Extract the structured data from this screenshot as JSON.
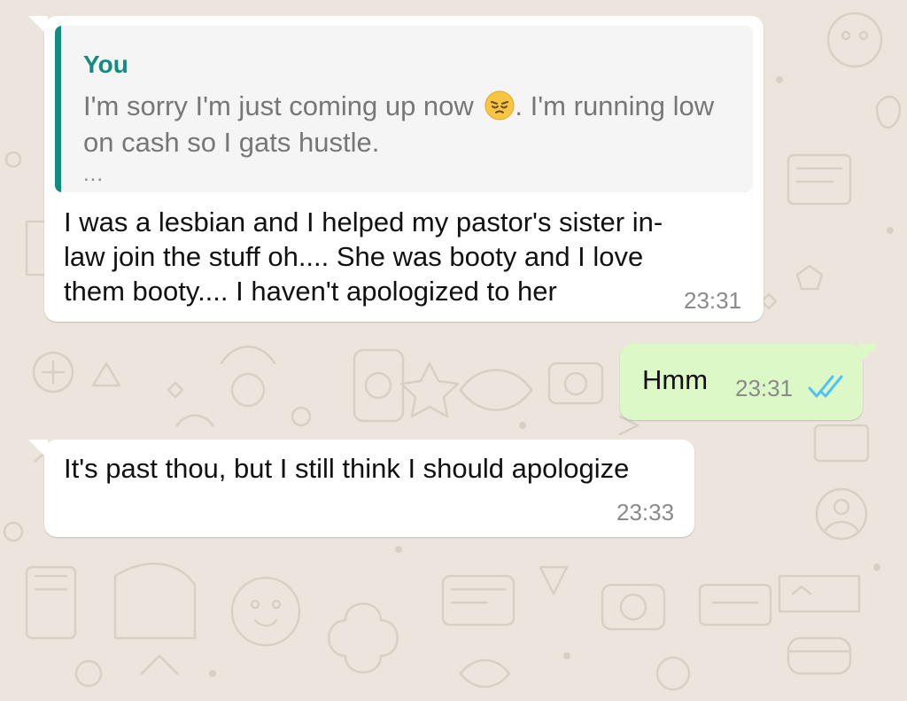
{
  "messages": [
    {
      "direction": "incoming",
      "quote": {
        "author": "You",
        "text_before_emoji": "I'm sorry I'm just coming up now ",
        "text_after_emoji": ". I'm running low on cash so I gats hustle.",
        "ellipsis": "...",
        "emoji": "pensive-face-emoji"
      },
      "lines": [
        "I was a lesbian and I helped my pastor's sister in-",
        "law join the stuff oh.... She was booty and I love",
        "them booty.... I haven't apologized to her"
      ],
      "time": "23:31"
    },
    {
      "direction": "outgoing",
      "text": "Hmm",
      "time": "23:31",
      "status": "read",
      "status_icon": "double-check-icon"
    },
    {
      "direction": "incoming",
      "text": "It's past thou, but I still think I should apologize",
      "time": "23:33"
    }
  ],
  "colors": {
    "wallpaper": "#ece5dd",
    "incoming_bubble": "#ffffff",
    "outgoing_bubble": "#dcf8c6",
    "quote_accent": "#128c7e",
    "read_ticks": "#4fc3f7",
    "timestamp": "#8a8a8a"
  }
}
